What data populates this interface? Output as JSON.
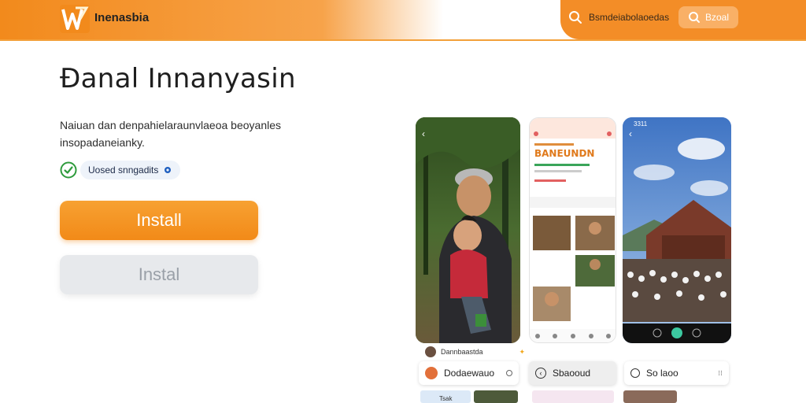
{
  "header": {
    "brand": "Inenasbia",
    "search_placeholder": "Bsmdeiabolaoedas",
    "action_label": "Bzoal"
  },
  "main": {
    "title": "Đanal Innanyasin",
    "description": "Naiuan dan denpahielaraunvlaeoa beoyanles insopadaneianky.",
    "verified_label": "Uosed snngadits",
    "install_label": "Install",
    "secondary_label": "Instal"
  },
  "phones": {
    "phone2_headline": "BANEUNDN",
    "phone3_time": "3311"
  },
  "cards": {
    "small_label": "Dannbaastda",
    "card1_label": "Dodaewauo",
    "card2_label": "Sbaooud",
    "card3_label": "So laoo",
    "strip1_label": "Tsak"
  },
  "colors": {
    "accent": "#f28a1c",
    "accent_light": "#f9b066",
    "check": "#2e9b3c"
  }
}
